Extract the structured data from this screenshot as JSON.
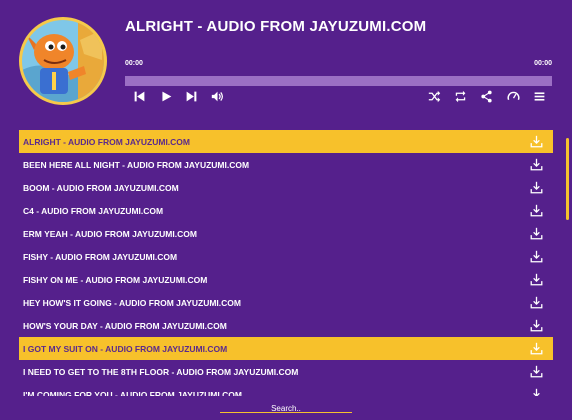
{
  "player": {
    "title": "ALRIGHT - AUDIO FROM JAYUZUMI.COM",
    "current_time": "00:00",
    "duration": "00:00",
    "progress": 0
  },
  "controls": [
    {
      "name": "previous-button",
      "icon": "previous-icon"
    },
    {
      "name": "play-button",
      "icon": "play-icon"
    },
    {
      "name": "next-button",
      "icon": "next-icon"
    },
    {
      "name": "volume-button",
      "icon": "volume-icon"
    },
    {
      "name": "shuffle-button",
      "icon": "shuffle-icon"
    },
    {
      "name": "repeat-button",
      "icon": "repeat-icon"
    },
    {
      "name": "share-button",
      "icon": "share-icon"
    },
    {
      "name": "speed-button",
      "icon": "speedometer-icon"
    },
    {
      "name": "playlist-menu-button",
      "icon": "menu-icon"
    }
  ],
  "playlist": [
    {
      "title": "ALRIGHT - AUDIO FROM JAYUZUMI.COM",
      "active": true
    },
    {
      "title": "BEEN HERE ALL NIGHT - AUDIO FROM JAYUZUMI.COM",
      "active": false
    },
    {
      "title": "BOOM - AUDIO FROM JAYUZUMI.COM",
      "active": false
    },
    {
      "title": "C4 - AUDIO FROM JAYUZUMI.COM",
      "active": false
    },
    {
      "title": "ERM YEAH - AUDIO FROM JAYUZUMI.COM",
      "active": false
    },
    {
      "title": "FISHY - AUDIO FROM JAYUZUMI.COM",
      "active": false
    },
    {
      "title": "FISHY ON ME - AUDIO FROM JAYUZUMI.COM",
      "active": false
    },
    {
      "title": "HEY HOW'S IT GOING - AUDIO FROM JAYUZUMI.COM",
      "active": false
    },
    {
      "title": "HOW'S YOUR DAY - AUDIO FROM JAYUZUMI.COM",
      "active": false
    },
    {
      "title": "I GOT MY SUIT ON - AUDIO FROM JAYUZUMI.COM",
      "active": true
    },
    {
      "title": "I NEED TO GET TO THE 8TH FLOOR - AUDIO FROM JAYUZUMI.COM",
      "active": false
    },
    {
      "title": "I'M COMING FOR YOU - AUDIO FROM JAYUZUMI.COM",
      "active": false
    }
  ],
  "search": {
    "placeholder": "Search.."
  },
  "colors": {
    "background": "#55208c",
    "accent": "#f5c12e",
    "progress_track": "#9b6fc4"
  }
}
